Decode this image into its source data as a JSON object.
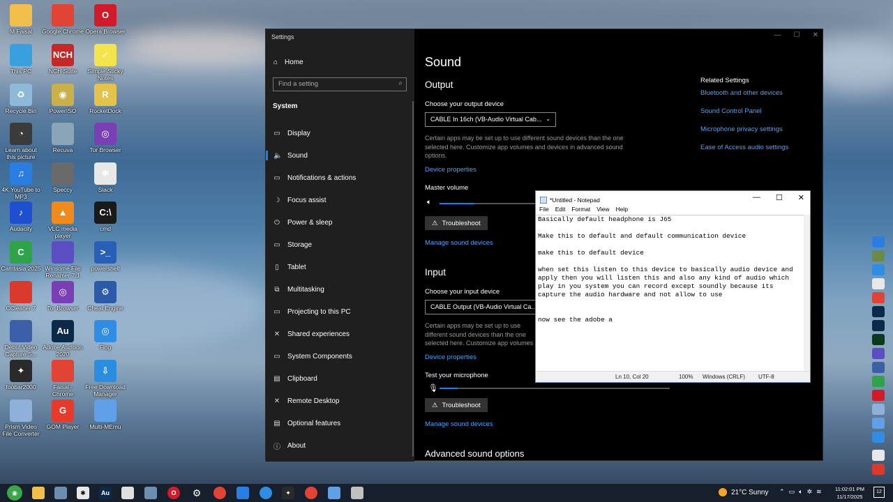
{
  "desktop": {
    "icons": [
      {
        "label": "M Faisal",
        "color": "#f2c04a",
        "glyph": ""
      },
      {
        "label": "Google Chrome",
        "color": "#e14335",
        "glyph": ""
      },
      {
        "label": "Opera Browser",
        "color": "#d11a2a",
        "glyph": "O"
      },
      {
        "label": "This PC",
        "color": "#39a0e0",
        "glyph": ""
      },
      {
        "label": "NCH Suite",
        "color": "#c62828",
        "glyph": "NCH"
      },
      {
        "label": "Simple Sticky Notes",
        "color": "#f4e34a",
        "glyph": "✓"
      },
      {
        "label": "Recycle Bin",
        "color": "#8fb9d9",
        "glyph": "♻"
      },
      {
        "label": "PowerISO",
        "color": "#c9b04a",
        "glyph": "◉"
      },
      {
        "label": "RocketDock",
        "color": "#e3c34c",
        "glyph": "R"
      },
      {
        "label": "Learn about this picture",
        "color": "#3b3b3b",
        "glyph": "◔"
      },
      {
        "label": "Recuva",
        "color": "#8aa4b8",
        "glyph": ""
      },
      {
        "label": "Tor Browser",
        "color": "#7b3fb5",
        "glyph": "◎"
      },
      {
        "label": "4K YouTube to MP3",
        "color": "#2a7de1",
        "glyph": "♫"
      },
      {
        "label": "Speccy",
        "color": "#6a6a6a",
        "glyph": ""
      },
      {
        "label": "Slack",
        "color": "#e8e8e8",
        "glyph": "✱"
      },
      {
        "label": "Audacity",
        "color": "#1f4fd1",
        "glyph": "♪"
      },
      {
        "label": "VLC media player",
        "color": "#f08a1c",
        "glyph": "▲"
      },
      {
        "label": "cmd",
        "color": "#1a1a1a",
        "glyph": "C:\\"
      },
      {
        "label": "Camtasia 2025",
        "color": "#2fa34a",
        "glyph": "C"
      },
      {
        "label": "Winsome File Renamer 7.1",
        "color": "#5b4ec2",
        "glyph": ""
      },
      {
        "label": "powershell",
        "color": "#2a5fb8",
        "glyph": ">_"
      },
      {
        "label": "CCleaner 7",
        "color": "#d93a2b",
        "glyph": ""
      },
      {
        "label": "Tor Browser",
        "color": "#7b3fb5",
        "glyph": "◎"
      },
      {
        "label": "Cheat Engine",
        "color": "#2c5aa8",
        "glyph": "⚙"
      },
      {
        "label": "Debut Video Capture S...",
        "color": "#3d5fa8",
        "glyph": ""
      },
      {
        "label": "Adobe Audition 2020",
        "color": "#0b2a4a",
        "glyph": "Au"
      },
      {
        "label": "Fing",
        "color": "#2f8de4",
        "glyph": "◎"
      },
      {
        "label": "foobar2000",
        "color": "#2a2a2a",
        "glyph": "✦"
      },
      {
        "label": "Faisal - Chrome",
        "color": "#e14335",
        "glyph": ""
      },
      {
        "label": "Free Download Manager",
        "color": "#2a8de0",
        "glyph": "⇩"
      },
      {
        "label": "Prism Video File Converter",
        "color": "#8fb0d8",
        "glyph": ""
      },
      {
        "label": "GOM Player",
        "color": "#e83a2a",
        "glyph": "G"
      },
      {
        "label": "Multi-MEmu",
        "color": "#5fa0e8",
        "glyph": ""
      }
    ]
  },
  "settings": {
    "window_title": "Settings",
    "nav": {
      "home": "Home",
      "search_placeholder": "Find a setting",
      "section": "System",
      "items": [
        {
          "label": "Display",
          "icon": "monitor-icon",
          "glyph": "▭"
        },
        {
          "label": "Sound",
          "icon": "speaker-icon",
          "glyph": "🔈"
        },
        {
          "label": "Notifications & actions",
          "icon": "notification-icon",
          "glyph": "▭"
        },
        {
          "label": "Focus assist",
          "icon": "moon-icon",
          "glyph": "☽"
        },
        {
          "label": "Power & sleep",
          "icon": "power-icon",
          "glyph": "⏻"
        },
        {
          "label": "Storage",
          "icon": "storage-icon",
          "glyph": "▭"
        },
        {
          "label": "Tablet",
          "icon": "tablet-icon",
          "glyph": "▯"
        },
        {
          "label": "Multitasking",
          "icon": "multitasking-icon",
          "glyph": "⧉"
        },
        {
          "label": "Projecting to this PC",
          "icon": "projector-icon",
          "glyph": "▭"
        },
        {
          "label": "Shared experiences",
          "icon": "share-icon",
          "glyph": "✕"
        },
        {
          "label": "System Components",
          "icon": "components-icon",
          "glyph": "▭"
        },
        {
          "label": "Clipboard",
          "icon": "clipboard-icon",
          "glyph": "▤"
        },
        {
          "label": "Remote Desktop",
          "icon": "remote-desktop-icon",
          "glyph": "✕"
        },
        {
          "label": "Optional features",
          "icon": "features-icon",
          "glyph": "▤"
        },
        {
          "label": "About",
          "icon": "info-icon",
          "glyph": "ⓘ"
        }
      ]
    },
    "main": {
      "title": "Sound",
      "output": {
        "heading": "Output",
        "choose_label": "Choose your output device",
        "device": "CABLE In 16ch (VB-Audio Virtual Cab...",
        "desc": "Certain apps may be set up to use different sound devices than the one selected here. Customize app volumes and devices in advanced sound options.",
        "device_properties": "Device properties",
        "master_volume": "Master volume",
        "volume_level": 0.35,
        "troubleshoot": "Troubleshoot",
        "manage": "Manage sound devices"
      },
      "input": {
        "heading": "Input",
        "choose_label": "Choose your input device",
        "device": "CABLE Output (VB-Audio Virtual Ca...",
        "desc": "Certain apps may be set up to use different sound devices than the one selected here. Customize app volumes and devices in advanced sound options.",
        "device_properties": "Device properties",
        "test_mic": "Test your microphone",
        "mic_level": 0.08,
        "troubleshoot": "Troubleshoot",
        "manage": "Manage sound devices"
      },
      "advanced": "Advanced sound options",
      "related": {
        "heading": "Related Settings",
        "links": [
          "Bluetooth and other devices",
          "Sound Control Panel",
          "Microphone privacy settings",
          "Ease of Access audio settings"
        ]
      }
    }
  },
  "notepad": {
    "title": "*Untitled - Notepad",
    "menu": [
      "File",
      "Edit",
      "Format",
      "View",
      "Help"
    ],
    "text": "Basically default headphone is J65\n\nMake this to default and default communication device\n\nmake this to default device\n\nwhen set this listen to this device to basically audio device and apply then you will listen this and also any kind of audio which play in you system you can record except soundly because its capture the audio hardware and not allow to use\n\n\nnow see the adobe a",
    "status": {
      "position": "Ln 10, Col 20",
      "zoom": "100%",
      "eol": "Windows (CRLF)",
      "encoding": "UTF-8"
    }
  },
  "taskbar": {
    "weather": "21°C  Sunny",
    "time": "11:02:01 PM",
    "date": "11/17/2025",
    "notifications": "12"
  }
}
